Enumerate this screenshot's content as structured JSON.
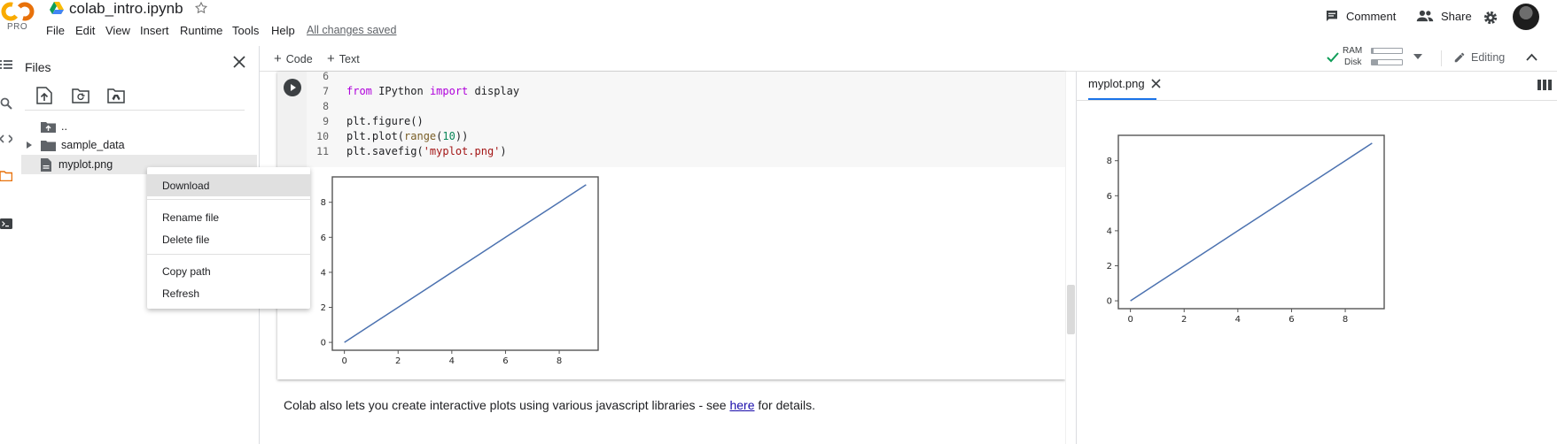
{
  "header": {
    "logo_text": "CO",
    "plan": "PRO",
    "notebook_title": "colab_intro.ipynb",
    "menu": [
      "File",
      "Edit",
      "View",
      "Insert",
      "Runtime",
      "Tools",
      "Help"
    ],
    "saved_status": "All changes saved",
    "comment_label": "Comment",
    "share_label": "Share"
  },
  "toolbar": {
    "add_code_label": "Code",
    "add_text_label": "Text",
    "ram_label": "RAM",
    "disk_label": "Disk",
    "ram_usage": 0.05,
    "disk_usage": 0.2,
    "editing_label": "Editing"
  },
  "files_panel": {
    "title": "Files",
    "items": [
      {
        "name": "..",
        "type": "parent"
      },
      {
        "name": "sample_data",
        "type": "folder"
      },
      {
        "name": "myplot.png",
        "type": "file"
      }
    ]
  },
  "context_menu": {
    "items": [
      "Download",
      "Rename file",
      "Delete file",
      "Copy path",
      "Refresh"
    ],
    "highlighted": "Download"
  },
  "code_cell": {
    "line_numbers": [
      "6",
      "7",
      "8",
      "9",
      "10",
      "11"
    ],
    "line7": {
      "kw_from": "from",
      "mod": " IPython ",
      "kw_import": "import",
      "rest": " display"
    },
    "line9": "plt.figure()",
    "line10": {
      "pre": "plt.plot(",
      "func": "range",
      "open": "(",
      "num": "10",
      "close": "))"
    },
    "line11": {
      "pre": "plt.savefig(",
      "str": "'myplot.png'",
      "post": ")"
    }
  },
  "text_cell": {
    "before": "Colab also lets you create interactive plots using various javascript libraries - see ",
    "link": "here",
    "after": " for details."
  },
  "right_pane": {
    "tab_label": "myplot.png"
  },
  "chart_data": [
    {
      "type": "line",
      "x": [
        0,
        1,
        2,
        3,
        4,
        5,
        6,
        7,
        8,
        9
      ],
      "series": [
        {
          "values": [
            0,
            1,
            2,
            3,
            4,
            5,
            6,
            7,
            8,
            9
          ]
        }
      ],
      "xticks": [
        "0",
        "2",
        "4",
        "6",
        "8"
      ],
      "yticks": [
        "0",
        "2",
        "4",
        "6",
        "8"
      ],
      "xlim": [
        -0.45,
        9.45
      ],
      "ylim": [
        -0.45,
        9.45
      ],
      "color": "#4c72b0"
    },
    {
      "type": "line",
      "x": [
        0,
        1,
        2,
        3,
        4,
        5,
        6,
        7,
        8,
        9
      ],
      "series": [
        {
          "values": [
            0,
            1,
            2,
            3,
            4,
            5,
            6,
            7,
            8,
            9
          ]
        }
      ],
      "xticks": [
        "0",
        "2",
        "4",
        "6",
        "8"
      ],
      "yticks": [
        "0",
        "2",
        "4",
        "6",
        "8"
      ],
      "xlim": [
        -0.45,
        9.45
      ],
      "ylim": [
        -0.45,
        9.45
      ],
      "color": "#4c72b0"
    }
  ]
}
